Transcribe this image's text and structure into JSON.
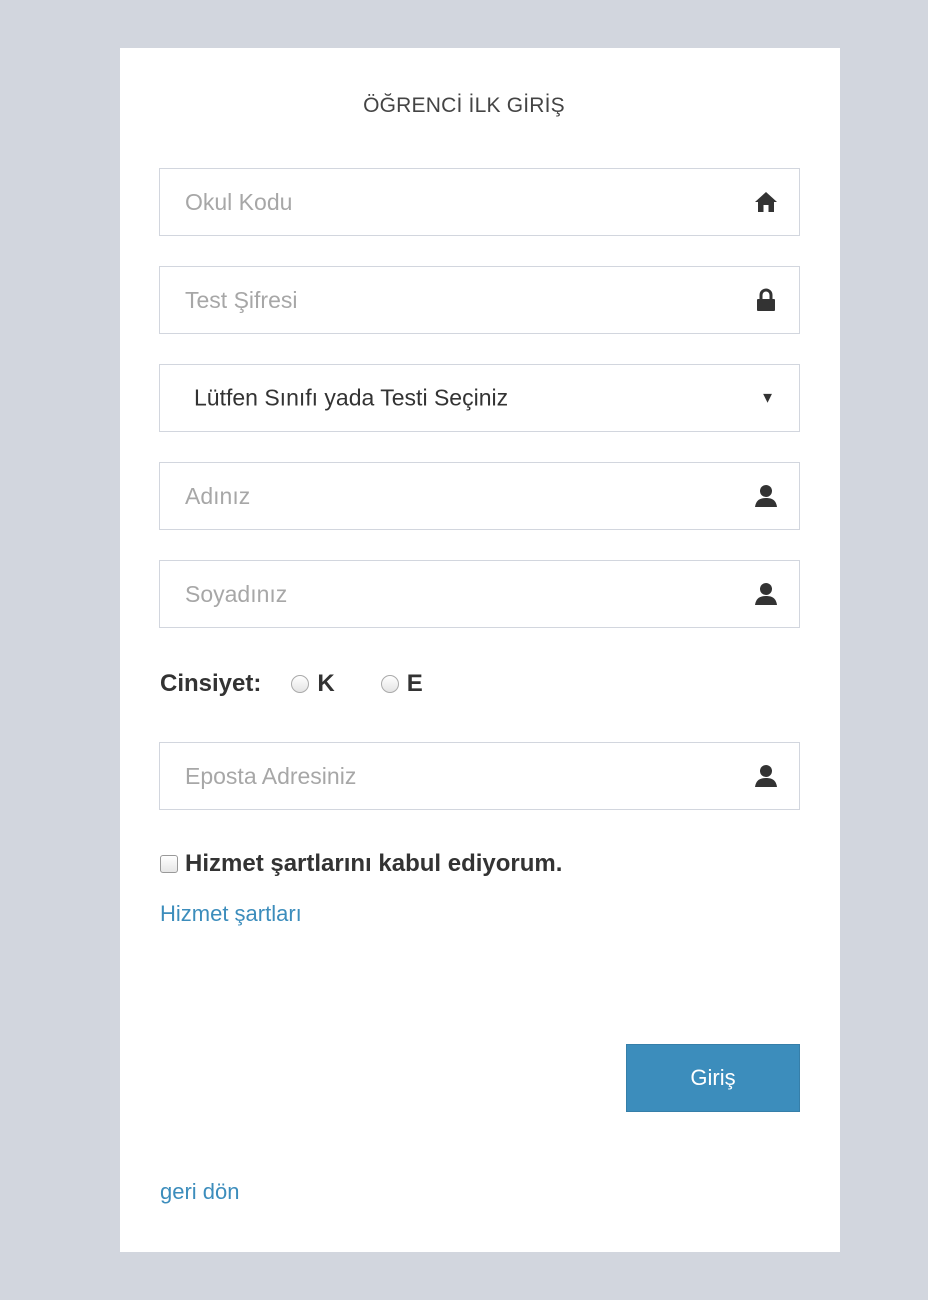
{
  "form": {
    "title": "ÖĞRENCİ İLK GİRİŞ",
    "school_code": {
      "placeholder": "Okul Kodu",
      "icon": "home-icon"
    },
    "test_password": {
      "placeholder": "Test Şifresi",
      "icon": "lock-icon"
    },
    "class_select": {
      "selected": "Lütfen Sınıfı yada Testi Seçiniz",
      "caret": "▼"
    },
    "first_name": {
      "placeholder": "Adınız",
      "icon": "user-icon"
    },
    "last_name": {
      "placeholder": "Soyadınız",
      "icon": "user-icon"
    },
    "gender": {
      "label": "Cinsiyet:",
      "options": [
        "K",
        "E"
      ]
    },
    "email": {
      "placeholder": "Eposta Adresiniz",
      "icon": "user-icon"
    },
    "terms": {
      "label": "Hizmet şartlarını kabul ediyorum.",
      "link": "Hizmet şartları"
    },
    "submit_label": "Giriş",
    "back_link": "geri dön"
  },
  "colors": {
    "page_background": "#d2d6de",
    "card_background": "#ffffff",
    "accent": "#3c8dbc",
    "field_border": "#d2d6de"
  }
}
